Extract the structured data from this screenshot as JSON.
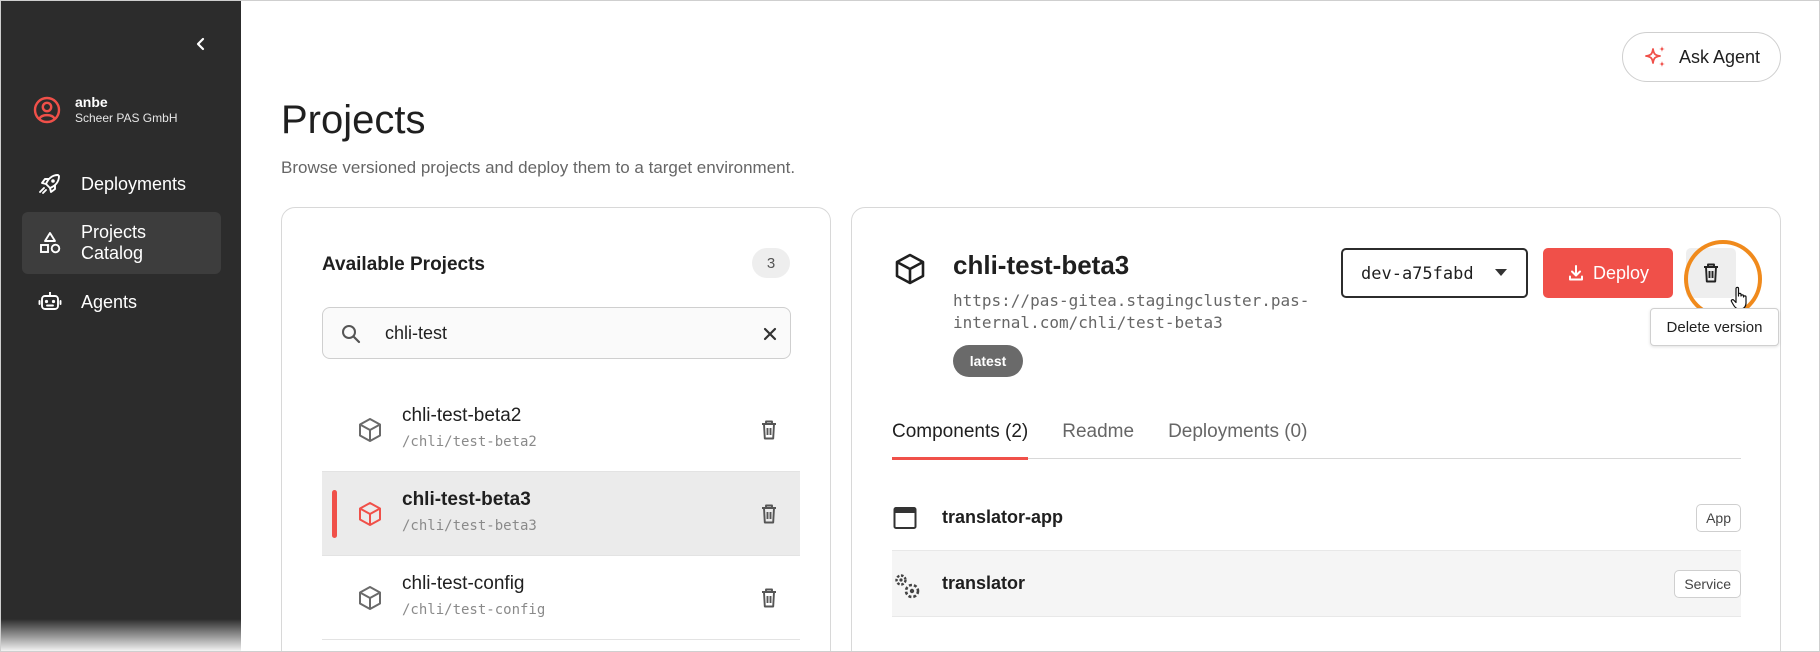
{
  "sidebar": {
    "user": {
      "name": "anbe",
      "org": "Scheer PAS GmbH"
    },
    "nav": [
      {
        "label": "Deployments",
        "icon": "rocket-icon",
        "active": false
      },
      {
        "label": "Projects Catalog",
        "icon": "shapes-icon",
        "active": true
      },
      {
        "label": "Agents",
        "icon": "robot-icon",
        "active": false
      }
    ]
  },
  "header": {
    "ask_agent_label": "Ask Agent"
  },
  "page": {
    "title": "Projects",
    "subtitle": "Browse versioned projects and deploy them to a target environment."
  },
  "available": {
    "title": "Available Projects",
    "count": "3",
    "search_value": "chli-test",
    "projects": [
      {
        "name": "chli-test-beta2",
        "path": "/chli/test-beta2",
        "selected": false
      },
      {
        "name": "chli-test-beta3",
        "path": "/chli/test-beta3",
        "selected": true
      },
      {
        "name": "chli-test-config",
        "path": "/chli/test-config",
        "selected": false
      }
    ]
  },
  "detail": {
    "name": "chli-test-beta3",
    "url": "https://pas-gitea.stagingcluster.pas-internal.com/chli/test-beta3",
    "badge": "latest",
    "version": "dev-a75fabd",
    "deploy_label": "Deploy",
    "tooltip": "Delete version",
    "tabs": [
      {
        "label": "Components (2)",
        "active": true
      },
      {
        "label": "Readme",
        "active": false
      },
      {
        "label": "Deployments (0)",
        "active": false
      }
    ],
    "components": [
      {
        "name": "translator-app",
        "type": "App",
        "icon": "window-icon"
      },
      {
        "name": "translator",
        "type": "Service",
        "icon": "gears-icon"
      }
    ]
  },
  "colors": {
    "sidebar_bg": "#2c2c2c",
    "accent": "#f05049",
    "highlight_ring": "#f08a1c"
  }
}
